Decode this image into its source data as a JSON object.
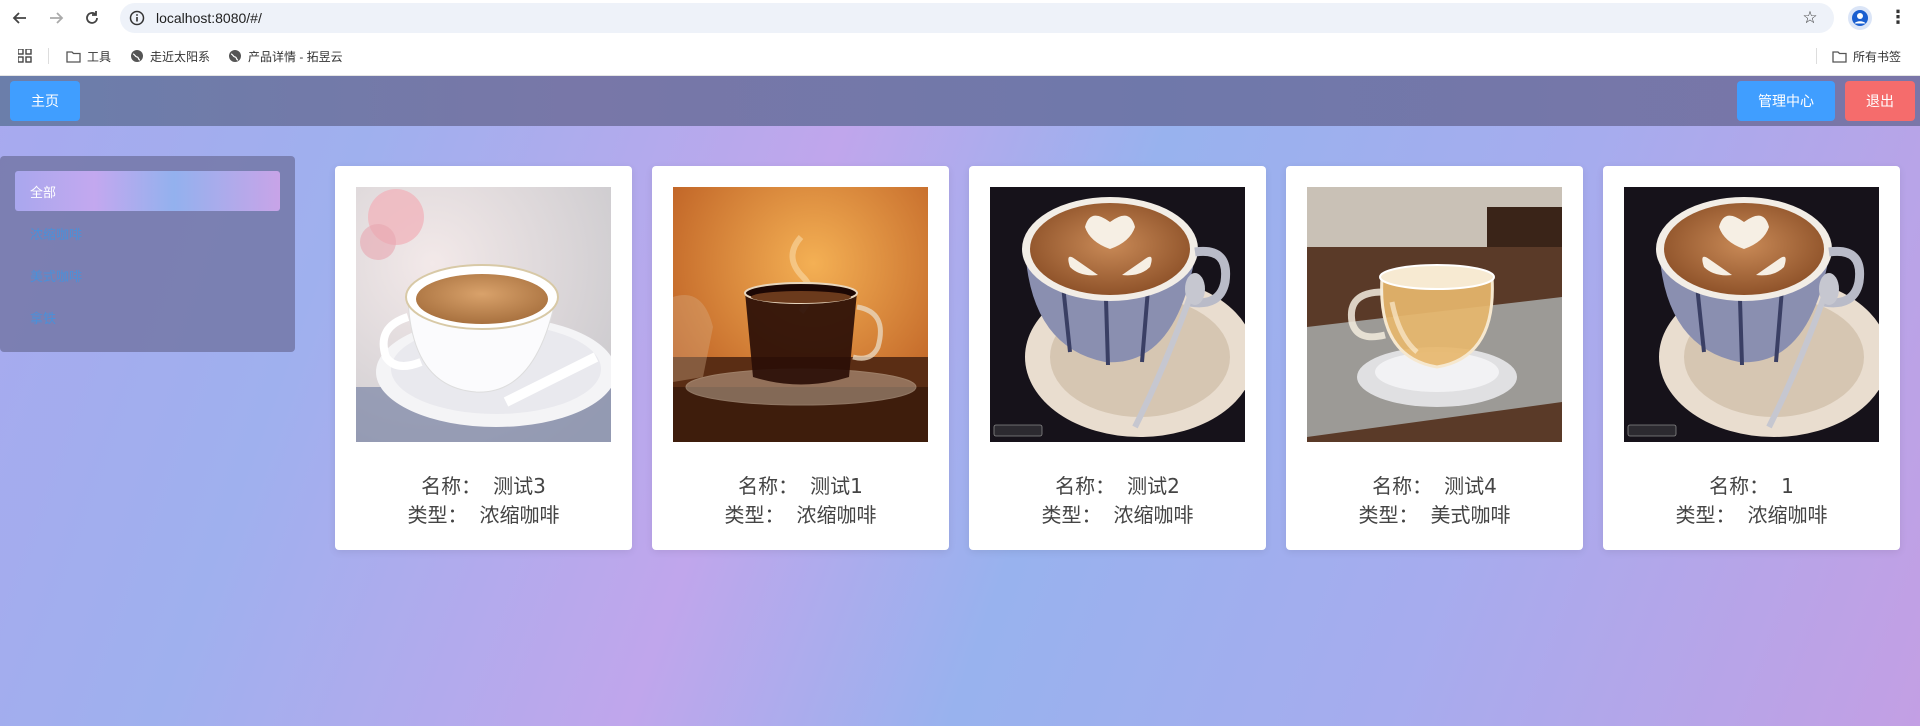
{
  "browser": {
    "url": "localhost:8080/#/",
    "bookmarks": [
      {
        "label": "工具",
        "icon": "folder-icon"
      },
      {
        "label": "走近太阳系",
        "icon": "globe-icon"
      },
      {
        "label": "产品详情 - 拓昱云",
        "icon": "globe-icon"
      }
    ],
    "all_bookmarks": "所有书签"
  },
  "header": {
    "home_label": "主页",
    "admin_label": "管理中心",
    "logout_label": "退出"
  },
  "sidebar": {
    "items": [
      {
        "label": "全部",
        "active": true
      },
      {
        "label": "浓缩咖啡",
        "active": false
      },
      {
        "label": "美式咖啡",
        "active": false
      },
      {
        "label": "拿铁",
        "active": false
      }
    ]
  },
  "products": [
    {
      "name_label": "名称：",
      "name": "测试3",
      "type_label": "类型：",
      "type": "浓缩咖啡",
      "image": "white-cup-milk-coffee"
    },
    {
      "name_label": "名称：",
      "name": "测试1",
      "type_label": "类型：",
      "type": "浓缩咖啡",
      "image": "glass-cup-black-coffee"
    },
    {
      "name_label": "名称：",
      "name": "测试2",
      "type_label": "类型：",
      "type": "浓缩咖啡",
      "image": "latte-art-cup"
    },
    {
      "name_label": "名称：",
      "name": "测试4",
      "type_label": "类型：",
      "type": "美式咖啡",
      "image": "glass-cup-tea"
    },
    {
      "name_label": "名称：",
      "name": "1",
      "type_label": "类型：",
      "type": "浓缩咖啡",
      "image": "latte-art-cup"
    }
  ],
  "colors": {
    "primary": "#409eff",
    "danger": "#f56c6c"
  }
}
